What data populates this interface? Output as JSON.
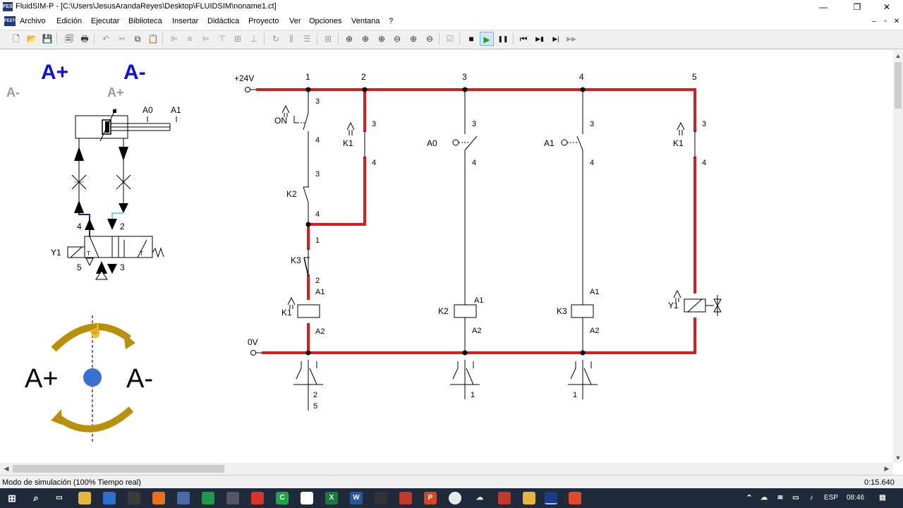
{
  "window": {
    "title": "FluidSIM-P - [C:\\Users\\JesusArandaReyes\\Desktop\\FLUIDSIM\\noname1.ct]",
    "app_logo": "FESTO",
    "minimize_glyph": "—",
    "restore_glyph": "❐",
    "close_glyph": "✕"
  },
  "menu": {
    "items": [
      "Archivo",
      "Edición",
      "Ejecutar",
      "Biblioteca",
      "Insertar",
      "Didáctica",
      "Proyecto",
      "Ver",
      "Opciones",
      "Ventana",
      "?"
    ],
    "mdi_min": "–",
    "mdi_restore": "▫",
    "mdi_close": "✕"
  },
  "toolbar": {
    "icons": [
      "new-icon",
      "open-icon",
      "save-icon",
      "print-preview-icon",
      "print-icon",
      "undo-icon",
      "cut-icon",
      "copy-icon",
      "paste-icon",
      "align-left-icon",
      "align-center-icon",
      "align-right-icon",
      "align-top-icon",
      "align-middle-icon",
      "align-bottom-icon",
      "rotate-icon",
      "distribute-h-icon",
      "distribute-v-icon",
      "grid-icon",
      "zoom-original-icon",
      "zoom-window-icon",
      "zoom-all-icon",
      "zoom-previous-icon",
      "zoom-in-icon",
      "zoom-out-icon",
      "check-icon",
      "stop-icon",
      "play-icon",
      "pause-icon",
      "reset-icon",
      "step-icon",
      "step-to-end-icon",
      "fast-forward-icon"
    ],
    "stop_glyph": "■",
    "play_glyph": "▶",
    "pause_glyph": "❚❚",
    "reset_glyph": "⏮",
    "step_glyph": "▶▮",
    "step_end_glyph": "▶|",
    "ff_glyph": "▶▶",
    "accent_active": "#1aa31a"
  },
  "pneumatic": {
    "header_a_plus": "A+",
    "header_a_minus": "A-",
    "sub_a_minus": "A-",
    "sub_a_plus": "A+",
    "sensor_a0": "A0",
    "sensor_a1": "A1",
    "port_4": "4",
    "port_2": "2",
    "port_5": "5",
    "port_3": "3",
    "solenoid": "Y1",
    "rotation_a_plus": "A+",
    "rotation_a_minus": "A-",
    "header_color": "#1010dd",
    "arrow_color": "#b8900a",
    "dot_color": "#3b6fd1"
  },
  "circuit": {
    "supply_pos": "+24V",
    "supply_neg": "0V",
    "rail_numbers": [
      "1",
      "2",
      "3",
      "4",
      "5"
    ],
    "energized_color": "#d21e1e",
    "labels": {
      "on": "ON",
      "k1": "K1",
      "k2": "K2",
      "k3": "K3",
      "a0": "A0",
      "a1": "A1",
      "y1": "Y1",
      "t3": "3",
      "t4": "4",
      "t1": "1",
      "t2": "2",
      "ta1": "A1",
      "ta2": "A2",
      "ref_2": "2",
      "ref_5": "5",
      "ref_1": "1"
    }
  },
  "scroll": {
    "up": "▲",
    "down": "▼",
    "left": "◀",
    "right": "▶"
  },
  "status": {
    "mode": "Modo de simulación (100% Tiempo real)",
    "time": "0:15.640"
  },
  "taskbar": {
    "language": "ESP",
    "clock": "08:46"
  }
}
